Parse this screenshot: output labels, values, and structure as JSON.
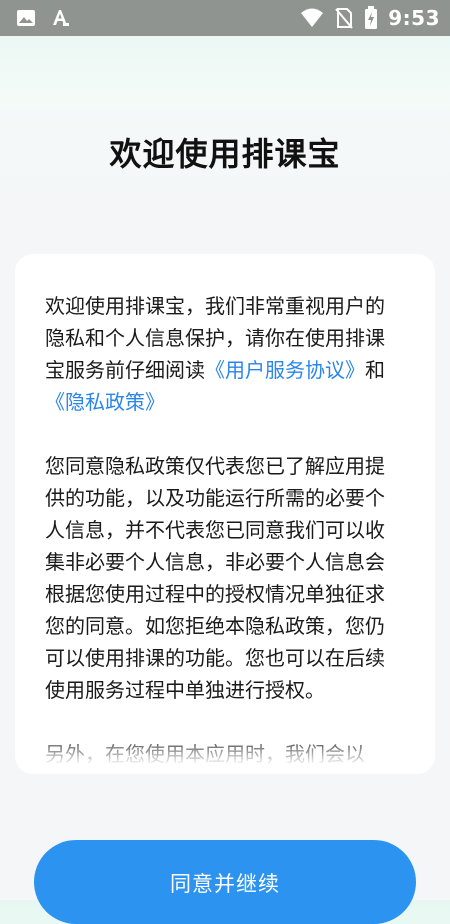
{
  "status_bar": {
    "time": "9:53",
    "left_icons": [
      "image-icon",
      "font-icon"
    ],
    "right_icons": [
      "wifi-icon",
      "no-sim-icon",
      "battery-icon"
    ],
    "color": "#8f9491"
  },
  "title": "欢迎使用排课宝",
  "agreement": {
    "intro_prefix": "欢迎使用排课宝，我们非常重视用户的隐私和个人信息保护，请你在使用排课宝服务前仔细阅读",
    "user_agreement_link": "《用户服务协议》",
    "and_text": "和",
    "privacy_policy_link": "《隐私政策》",
    "paragraph2": "您同意隐私政策仅代表您已了解应用提供的功能，以及功能运行所需的必要个人信息，并不代表您已同意我们可以收集非必要个人信息，非必要个人信息会根据您使用过程中的授权情况单独征求您的同意。如您拒绝本隐私政策，您仍可以使用排课的功能。您也可以在后续使用服务过程中单独进行授权。",
    "paragraph3_partial": "另外，在您使用本应用时，我们会以"
  },
  "button": {
    "agree_label": "同意并继续"
  },
  "colors": {
    "link": "#2a86e8",
    "button": "#2c94f0"
  }
}
